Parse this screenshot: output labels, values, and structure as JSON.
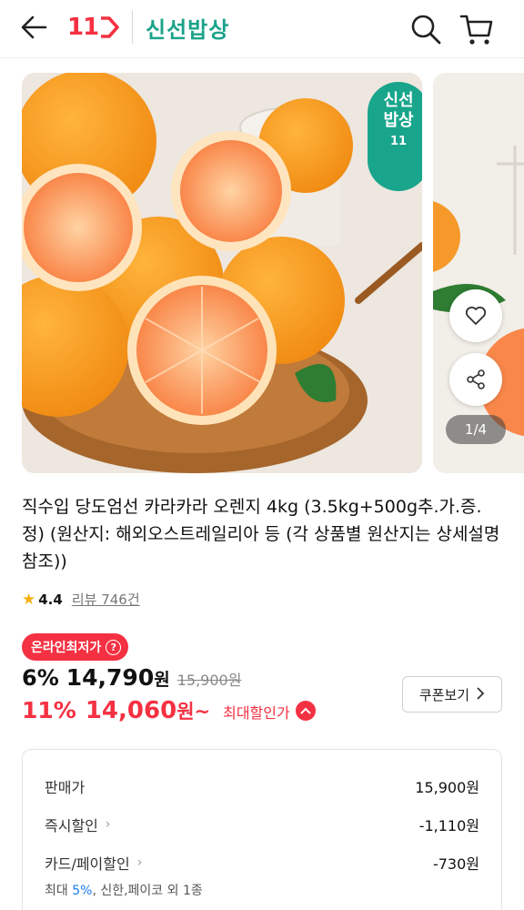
{
  "header": {
    "logo_text": "11",
    "brand": "신선밥상",
    "icons": [
      "back-arrow-icon",
      "search-icon",
      "cart-icon"
    ]
  },
  "gallery": {
    "badge_line1": "신선",
    "badge_line2": "밥상",
    "badge_logo": "11",
    "pager": "1/4",
    "colors": {
      "badge": "#19a58c"
    }
  },
  "product": {
    "title": "직수입 당도엄선 카라카라 오렌지 4kg (3.5kg+500g추.가.증.정) (원산지: 해외오스트레일리아 등 (각 상품별 원산지는 상세설명 참조))",
    "rating": "4.4",
    "reviews": "리뷰 746건"
  },
  "price": {
    "lowest_badge": "온라인최저가",
    "discount_pct": "6%",
    "sale_price": "14,790",
    "won": "원",
    "original": "15,900원",
    "max_pct": "11%",
    "max_price": "14,060",
    "max_won": "원~",
    "max_label": "최대할인가",
    "coupon_button": "쿠폰보기",
    "accent": "#f43142"
  },
  "breakdown": {
    "rows": [
      {
        "label": "판매가",
        "value": "15,900원"
      },
      {
        "label": "즉시할인",
        "value": "-1,110원"
      },
      {
        "label": "카드/페이할인",
        "value": "-730원"
      }
    ],
    "note_prefix": "최대 ",
    "note_highlight": "5%",
    "note_suffix": ", 신한,페이코 외 1종"
  }
}
